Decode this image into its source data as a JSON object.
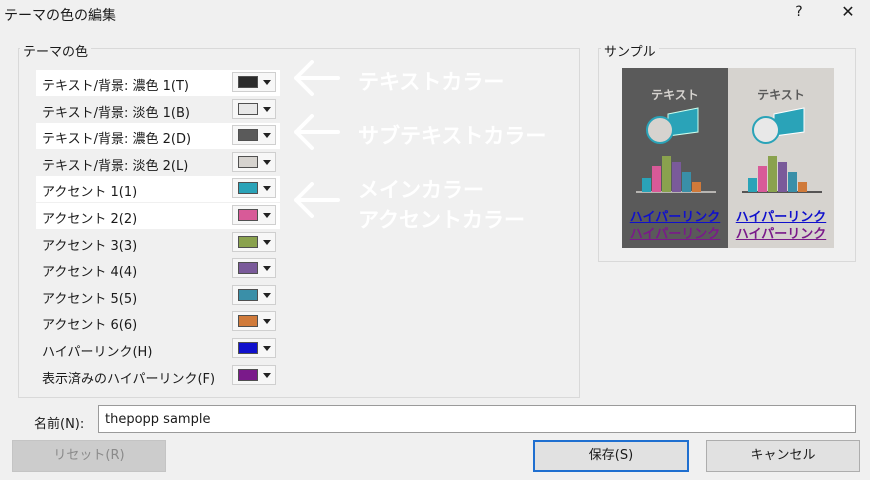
{
  "window": {
    "title": "テーマの色の編集",
    "help": "?",
    "close": "✕"
  },
  "theme_colors": {
    "label": "テーマの色",
    "rows": [
      {
        "label": "テキスト/背景: 濃色 1(T)",
        "color": "#2b2b2b",
        "highlighted": true
      },
      {
        "label": "テキスト/背景: 淡色 1(B)",
        "color": "#e8e8e8",
        "highlighted": false
      },
      {
        "label": "テキスト/背景: 濃色 2(D)",
        "color": "#5a5a5a",
        "highlighted": true
      },
      {
        "label": "テキスト/背景: 淡色 2(L)",
        "color": "#d6d3cf",
        "highlighted": false
      },
      {
        "label": "アクセント 1(1)",
        "color": "#2aa3b8",
        "highlighted": true
      },
      {
        "label": "アクセント 2(2)",
        "color": "#d85a98",
        "highlighted": true
      },
      {
        "label": "アクセント 3(3)",
        "color": "#8aa24e",
        "highlighted": false
      },
      {
        "label": "アクセント 4(4)",
        "color": "#7a5a9a",
        "highlighted": false
      },
      {
        "label": "アクセント 5(5)",
        "color": "#3a8fa8",
        "highlighted": false
      },
      {
        "label": "アクセント 6(6)",
        "color": "#d07a3a",
        "highlighted": false
      },
      {
        "label": "ハイパーリンク(H)",
        "color": "#1010cc",
        "highlighted": false
      },
      {
        "label": "表示済みのハイパーリンク(F)",
        "color": "#7a1a8a",
        "highlighted": false
      }
    ]
  },
  "annotations": {
    "text_color": "テキストカラー",
    "subtext_color": "サブテキストカラー",
    "main_color": "メインカラー",
    "accent_color": "アクセントカラー"
  },
  "sample": {
    "label": "サンプル",
    "text": "テキスト",
    "hyperlink": "ハイパーリンク",
    "visited_hyperlink": "ハイパーリンク"
  },
  "name": {
    "label": "名前(N):",
    "value": "thepopp sample"
  },
  "buttons": {
    "reset": "リセット(R)",
    "save": "保存(S)",
    "cancel": "キャンセル"
  }
}
